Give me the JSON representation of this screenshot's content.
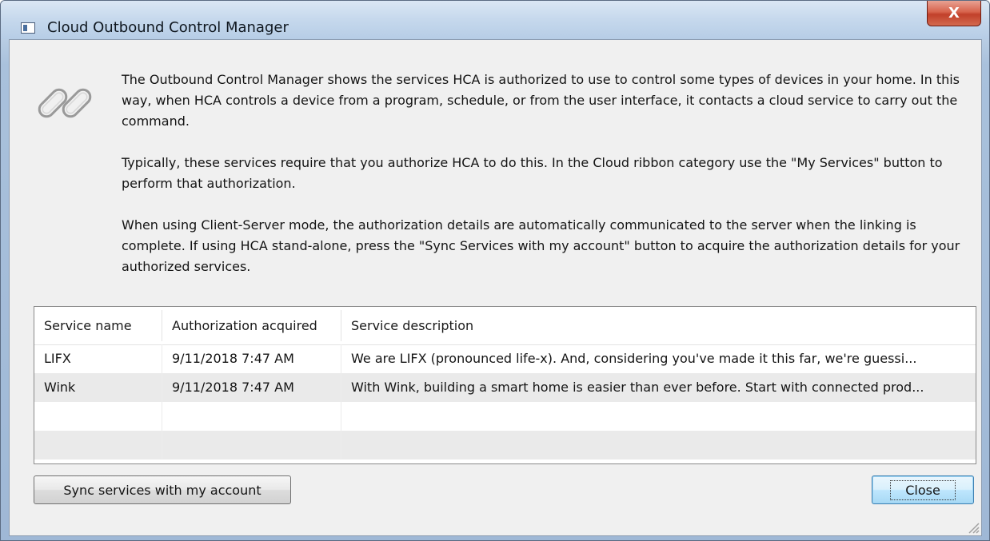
{
  "window": {
    "title": "Cloud Outbound Control Manager",
    "close_glyph": "X"
  },
  "intro": {
    "icon": "chain-link-icon",
    "paragraph_1": "The Outbound Control Manager shows the services HCA is authorized to use to control some types of devices in your home. In this way, when HCA controls a device from a program, schedule, or from the user interface, it contacts a cloud service to carry out the command.",
    "paragraph_2": "Typically, these services require that you authorize HCA to do this. In the Cloud ribbon category use the \"My Services\" button to perform that authorization.",
    "paragraph_3": "When using Client-Server mode, the authorization details are automatically communicated to the server when the linking is complete. If using HCA stand-alone, press the \"Sync Services with my account\" button to acquire the authorization details for your authorized services."
  },
  "table": {
    "columns": [
      "Service name",
      "Authorization acquired",
      "Service description"
    ],
    "rows": [
      [
        "LIFX",
        "9/11/2018 7:47 AM",
        "We are LIFX (pronounced life-x). And, considering you've made it this far, we're guessi..."
      ],
      [
        "Wink",
        "9/11/2018 7:47 AM",
        "With Wink, building a smart home is easier than ever before. Start with connected prod..."
      ],
      [
        "",
        "",
        ""
      ],
      [
        "",
        "",
        ""
      ]
    ]
  },
  "buttons": {
    "sync_label": "Sync services with my account",
    "close_label": "Close"
  },
  "colors": {
    "close_button": "#c1402a",
    "default_button_border": "#3c7fb1"
  }
}
